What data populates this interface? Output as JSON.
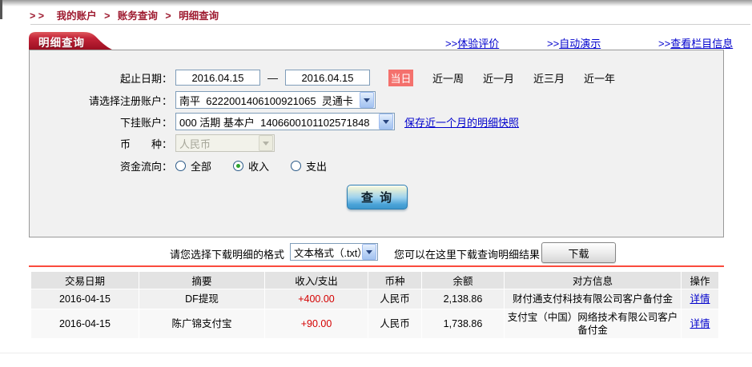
{
  "breadcrumb": {
    "prefix": "> >",
    "separator": ">",
    "items": [
      "我的账户",
      "账务查询",
      "明细查询"
    ]
  },
  "tab": {
    "label": "明细查询"
  },
  "toolbar_links": [
    {
      "prefix": ">>",
      "label": "体验评价"
    },
    {
      "prefix": ">>",
      "label": "自动演示"
    },
    {
      "prefix": ">>",
      "label": "查看栏目信息"
    }
  ],
  "form": {
    "date_row": {
      "label": "起止日期：",
      "from": "2016.04.15",
      "to": "2016.04.15",
      "separator": "—",
      "today": "当日",
      "ranges": [
        "近一周",
        "近一月",
        "近三月",
        "近一年"
      ]
    },
    "account_row": {
      "label": "请选择注册账户：",
      "value": "南平  6222001406100921065  灵通卡"
    },
    "sub_account_row": {
      "label": "下挂账户：",
      "value": "000 活期 基本户  1406600101102571848",
      "link": "保存近一个月的明细快照"
    },
    "currency_row": {
      "label": "币　　种：",
      "value": "人民币"
    },
    "flow_row": {
      "label": "资金流向：",
      "options": [
        {
          "label": "全部",
          "selected": false
        },
        {
          "label": "收入",
          "selected": true
        },
        {
          "label": "支出",
          "selected": false
        }
      ]
    },
    "query_button": "查 询"
  },
  "download": {
    "format_label": "请您选择下载明细的格式",
    "format_value": "文本格式（.txt）",
    "result_label": "您可以在这里下载查询明细结果",
    "button": "下载"
  },
  "table": {
    "headers": [
      "交易日期",
      "摘要",
      "收入/支出",
      "币种",
      "余额",
      "对方信息",
      "操作"
    ],
    "rows": [
      {
        "date": "2016-04-15",
        "summary": "DF提现",
        "amount": "+400.00",
        "currency": "人民币",
        "balance": "2,138.86",
        "counterparty": "财付通支付科技有限公司客户备付金",
        "action": "详情"
      },
      {
        "date": "2016-04-15",
        "summary": "陈广锦支付宝",
        "amount": "+90.00",
        "currency": "人民币",
        "balance": "1,738.86",
        "counterparty": "支付宝（中国）网络技术有限公司客户备付金",
        "action": "详情"
      }
    ]
  },
  "colors": {
    "accent_red": "#9e1b30",
    "tab_red": "#b2152a",
    "link_blue": "#0000cc",
    "today_badge_bg": "#f4716d",
    "amount_red": "#d40000",
    "form_bg": "#f1f1f1",
    "divider_red": "#fa4a3c"
  }
}
